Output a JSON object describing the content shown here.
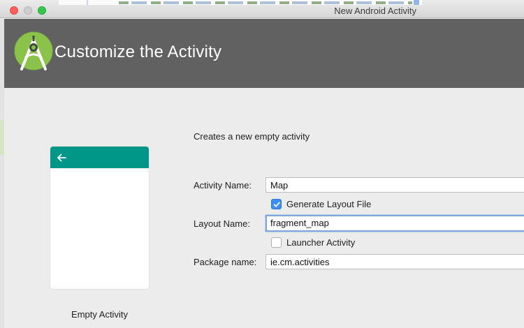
{
  "window": {
    "title": "New Android Activity"
  },
  "header": {
    "title": "Customize the Activity",
    "logo_icon": "android-studio-logo-icon",
    "background": "#616161"
  },
  "preview": {
    "template_name": "Empty Activity",
    "appbar_color": "#009688",
    "back_icon": "arrow-back-icon"
  },
  "form": {
    "description": "Creates a new empty activity",
    "activity_name": {
      "label": "Activity Name:",
      "value": "Map"
    },
    "generate_layout": {
      "label": "Generate Layout File",
      "checked": true
    },
    "layout_name": {
      "label": "Layout Name:",
      "value": "fragment_map"
    },
    "launcher_activity": {
      "label": "Launcher Activity",
      "checked": false
    },
    "package_name": {
      "label": "Package name:",
      "value": "ie.cm.activities"
    }
  },
  "colors": {
    "checkbox_accent": "#3b8cf3",
    "focus_ring": "#7fa7d8"
  }
}
